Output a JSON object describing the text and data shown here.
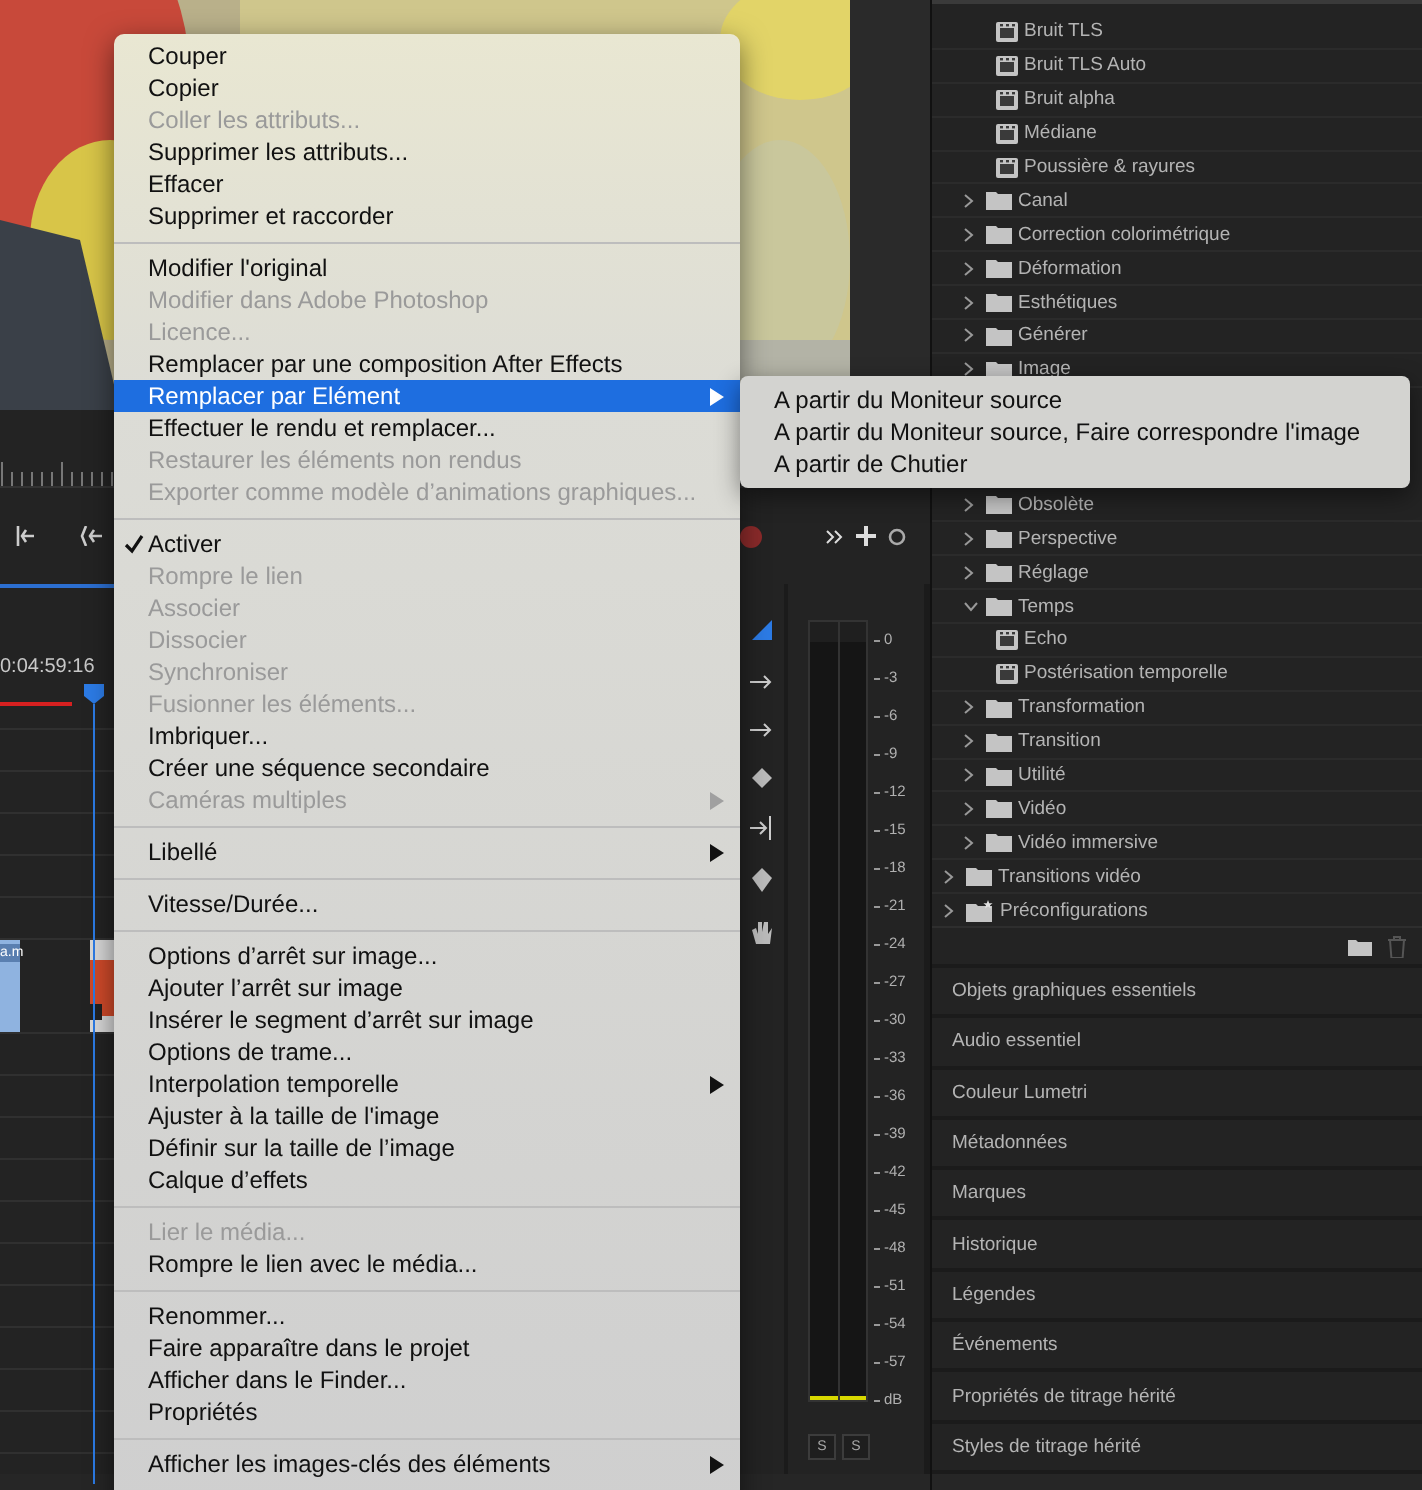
{
  "timeline": {
    "timecode": "0:04:59:16",
    "clip_label": "a.m"
  },
  "audio_meter": {
    "scale": [
      "0",
      "-3",
      "-6",
      "-9",
      "-12",
      "-15",
      "-18",
      "-21",
      "-24",
      "-27",
      "-30",
      "-33",
      "-36",
      "-39",
      "-42",
      "-45",
      "-48",
      "-51",
      "-54",
      "-57",
      "dB"
    ],
    "solo_buttons": [
      "S",
      "S"
    ]
  },
  "effects_tree": [
    {
      "kind": "continued",
      "children": [
        {
          "kind": "continued",
          "children": [
            {
              "kind": "effect",
              "label": "Bruit TLS"
            },
            {
              "kind": "effect",
              "label": "Bruit TLS Auto"
            },
            {
              "kind": "effect",
              "label": "Bruit alpha"
            },
            {
              "kind": "effect",
              "label": "Médiane"
            },
            {
              "kind": "effect",
              "label": "Poussière & rayures"
            }
          ]
        },
        {
          "kind": "folder",
          "label": "Canal",
          "expanded": false
        },
        {
          "kind": "folder",
          "label": "Correction colorimétrique",
          "expanded": false
        },
        {
          "kind": "folder",
          "label": "Déformation",
          "expanded": false
        },
        {
          "kind": "folder",
          "label": "Esthétiques",
          "expanded": false
        },
        {
          "kind": "folder",
          "label": "Générer",
          "expanded": false
        },
        {
          "kind": "folder",
          "label": "Image",
          "expanded": false
        },
        {
          "kind": "hidden"
        },
        {
          "kind": "hidden"
        },
        {
          "kind": "hidden"
        },
        {
          "kind": "folder",
          "label": "Obsolète",
          "expanded": false
        },
        {
          "kind": "folder",
          "label": "Perspective",
          "expanded": false
        },
        {
          "kind": "folder",
          "label": "Réglage",
          "expanded": false
        },
        {
          "kind": "folder",
          "label": "Temps",
          "expanded": true,
          "children": [
            {
              "kind": "effect",
              "label": "Echo"
            },
            {
              "kind": "effect",
              "label": "Postérisation temporelle"
            }
          ]
        },
        {
          "kind": "folder",
          "label": "Transformation",
          "expanded": false
        },
        {
          "kind": "folder",
          "label": "Transition",
          "expanded": false
        },
        {
          "kind": "folder",
          "label": "Utilité",
          "expanded": false
        },
        {
          "kind": "folder",
          "label": "Vidéo",
          "expanded": false
        },
        {
          "kind": "folder",
          "label": "Vidéo immersive",
          "expanded": false
        }
      ]
    },
    {
      "kind": "folder",
      "label": "Transitions vidéo",
      "expanded": false
    },
    {
      "kind": "preset",
      "label": "Préconfigurations",
      "expanded": false
    }
  ],
  "panels": [
    {
      "label": "Objets graphiques essentiels"
    },
    {
      "label": "Audio essentiel"
    },
    {
      "label": "Couleur Lumetri"
    },
    {
      "label": "Métadonnées"
    },
    {
      "label": "Marques"
    },
    {
      "label": "Historique"
    },
    {
      "label": "Légendes"
    },
    {
      "label": "Événements"
    },
    {
      "label": "Propriétés de titrage hérité"
    },
    {
      "label": "Styles de titrage hérité"
    }
  ],
  "context_menu": {
    "sections": [
      {
        "items": [
          {
            "label": "Couper",
            "disabled": false,
            "checked": false,
            "has_submenu": false,
            "selected": false
          },
          {
            "label": "Copier",
            "disabled": false,
            "checked": false,
            "has_submenu": false,
            "selected": false
          },
          {
            "label": "Coller les attributs...",
            "disabled": true,
            "checked": false,
            "has_submenu": false,
            "selected": false
          },
          {
            "label": "Supprimer les attributs...",
            "disabled": false,
            "checked": false,
            "has_submenu": false,
            "selected": false
          },
          {
            "label": "Effacer",
            "disabled": false,
            "checked": false,
            "has_submenu": false,
            "selected": false
          },
          {
            "label": "Supprimer et raccorder",
            "disabled": false,
            "checked": false,
            "has_submenu": false,
            "selected": false
          }
        ]
      },
      {
        "items": [
          {
            "label": "Modifier l'original",
            "disabled": false,
            "checked": false,
            "has_submenu": false,
            "selected": false
          },
          {
            "label": "Modifier dans Adobe Photoshop",
            "disabled": true,
            "checked": false,
            "has_submenu": false,
            "selected": false
          },
          {
            "label": "Licence...",
            "disabled": true,
            "checked": false,
            "has_submenu": false,
            "selected": false
          },
          {
            "label": "Remplacer par une composition After Effects",
            "disabled": false,
            "checked": false,
            "has_submenu": false,
            "selected": false
          },
          {
            "label": "Remplacer par Elément",
            "disabled": false,
            "checked": false,
            "has_submenu": true,
            "selected": true,
            "open_submenu": [
              {
                "label": "A partir du Moniteur source",
                "selected": false
              },
              {
                "label": "A partir du Moniteur source, Faire correspondre l'image",
                "selected": false
              },
              {
                "label": "A partir de Chutier",
                "selected": false
              }
            ]
          },
          {
            "label": "Effectuer le rendu et remplacer...",
            "disabled": false,
            "checked": false,
            "has_submenu": false,
            "selected": false
          },
          {
            "label": "Restaurer les éléments non rendus",
            "disabled": true,
            "checked": false,
            "has_submenu": false,
            "selected": false
          },
          {
            "label": "Exporter comme modèle d’animations graphiques...",
            "disabled": true,
            "checked": false,
            "has_submenu": false,
            "selected": false
          }
        ]
      },
      {
        "items": [
          {
            "label": "Activer",
            "disabled": false,
            "checked": true,
            "has_submenu": false,
            "selected": false
          },
          {
            "label": "Rompre le lien",
            "disabled": true,
            "checked": false,
            "has_submenu": false,
            "selected": false
          },
          {
            "label": "Associer",
            "disabled": true,
            "checked": false,
            "has_submenu": false,
            "selected": false
          },
          {
            "label": "Dissocier",
            "disabled": true,
            "checked": false,
            "has_submenu": false,
            "selected": false
          },
          {
            "label": "Synchroniser",
            "disabled": true,
            "checked": false,
            "has_submenu": false,
            "selected": false
          },
          {
            "label": "Fusionner les éléments...",
            "disabled": true,
            "checked": false,
            "has_submenu": false,
            "selected": false
          },
          {
            "label": "Imbriquer...",
            "disabled": false,
            "checked": false,
            "has_submenu": false,
            "selected": false
          },
          {
            "label": "Créer une séquence secondaire",
            "disabled": false,
            "checked": false,
            "has_submenu": false,
            "selected": false
          },
          {
            "label": "Caméras multiples",
            "disabled": true,
            "checked": false,
            "has_submenu": true,
            "selected": false
          }
        ]
      },
      {
        "items": [
          {
            "label": "Libellé",
            "disabled": false,
            "checked": false,
            "has_submenu": true,
            "selected": false
          }
        ]
      },
      {
        "items": [
          {
            "label": "Vitesse/Durée...",
            "disabled": false,
            "checked": false,
            "has_submenu": false,
            "selected": false
          }
        ]
      },
      {
        "items": [
          {
            "label": "Options d’arrêt sur image...",
            "disabled": false,
            "checked": false,
            "has_submenu": false,
            "selected": false
          },
          {
            "label": "Ajouter l’arrêt sur image",
            "disabled": false,
            "checked": false,
            "has_submenu": false,
            "selected": false
          },
          {
            "label": "Insérer le segment d’arrêt sur image",
            "disabled": false,
            "checked": false,
            "has_submenu": false,
            "selected": false
          },
          {
            "label": "Options de trame...",
            "disabled": false,
            "checked": false,
            "has_submenu": false,
            "selected": false
          },
          {
            "label": "Interpolation temporelle",
            "disabled": false,
            "checked": false,
            "has_submenu": true,
            "selected": false
          },
          {
            "label": "Ajuster à la taille de l'image",
            "disabled": false,
            "checked": false,
            "has_submenu": false,
            "selected": false
          },
          {
            "label": "Définir sur la taille de l’image",
            "disabled": false,
            "checked": false,
            "has_submenu": false,
            "selected": false
          },
          {
            "label": "Calque d’effets",
            "disabled": false,
            "checked": false,
            "has_submenu": false,
            "selected": false
          }
        ]
      },
      {
        "items": [
          {
            "label": "Lier le média...",
            "disabled": true,
            "checked": false,
            "has_submenu": false,
            "selected": false
          },
          {
            "label": "Rompre le lien avec le média...",
            "disabled": false,
            "checked": false,
            "has_submenu": false,
            "selected": false
          }
        ]
      },
      {
        "items": [
          {
            "label": "Renommer...",
            "disabled": false,
            "checked": false,
            "has_submenu": false,
            "selected": false
          },
          {
            "label": "Faire apparaître dans le projet",
            "disabled": false,
            "checked": false,
            "has_submenu": false,
            "selected": false
          },
          {
            "label": "Afficher dans le Finder...",
            "disabled": false,
            "checked": false,
            "has_submenu": false,
            "selected": false
          },
          {
            "label": "Propriétés",
            "disabled": false,
            "checked": false,
            "has_submenu": false,
            "selected": false
          }
        ]
      },
      {
        "items": [
          {
            "label": "Afficher les images-clés des éléments",
            "disabled": false,
            "checked": false,
            "has_submenu": true,
            "selected": false
          }
        ]
      }
    ]
  }
}
